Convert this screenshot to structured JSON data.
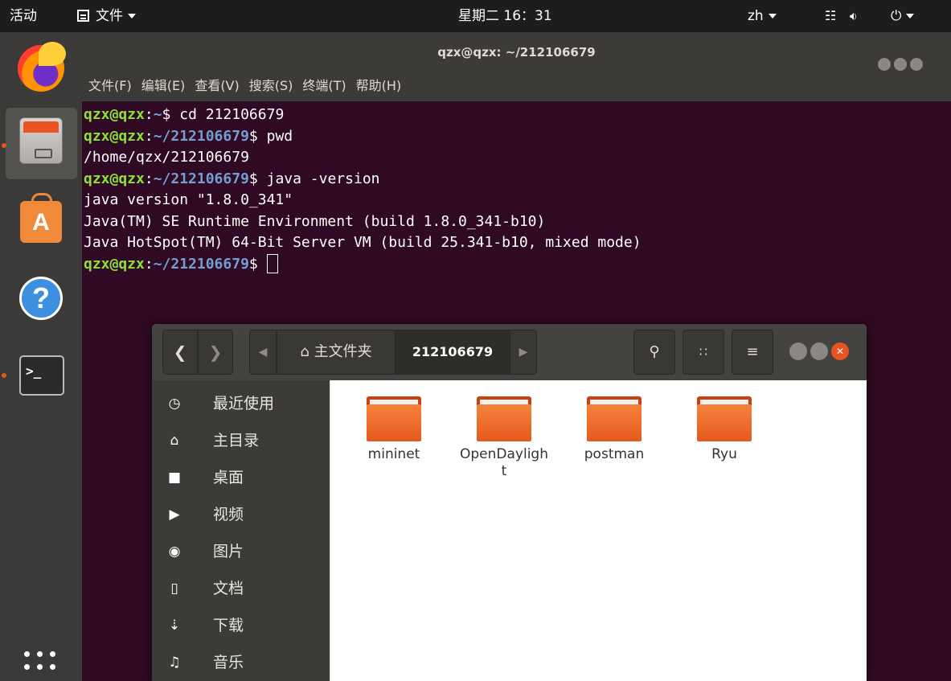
{
  "topbar": {
    "activities": "活动",
    "app_menu": "文件",
    "clock": "星期二 16：31",
    "input_method": "zh"
  },
  "dock": {
    "items": [
      "firefox",
      "files",
      "software",
      "help",
      "terminal"
    ]
  },
  "terminal": {
    "title": "qzx@qzx: ~/212106679",
    "menu": [
      "文件(F)",
      "编辑(E)",
      "查看(V)",
      "搜索(S)",
      "终端(T)",
      "帮助(H)"
    ],
    "prompt_user": "qzx@qzx",
    "lines": [
      {
        "prompt": true,
        "path": "~",
        "cmd": "cd 212106679"
      },
      {
        "prompt": true,
        "path": "~/212106679",
        "cmd": "pwd"
      },
      {
        "prompt": false,
        "text": "/home/qzx/212106679"
      },
      {
        "prompt": true,
        "path": "~/212106679",
        "cmd": "java -version"
      },
      {
        "prompt": false,
        "text": "java version \"1.8.0_341\""
      },
      {
        "prompt": false,
        "text": "Java(TM) SE Runtime Environment (build 1.8.0_341-b10)"
      },
      {
        "prompt": false,
        "text": "Java HotSpot(TM) 64-Bit Server VM (build 25.341-b10, mixed mode)"
      },
      {
        "prompt": true,
        "path": "~/212106679",
        "cmd": "",
        "cursor": true
      }
    ]
  },
  "file_manager": {
    "path_home": "主文件夹",
    "path_current": "212106679",
    "sidebar": [
      {
        "label": "最近使用",
        "icon": "clock-icon"
      },
      {
        "label": "主目录",
        "icon": "home-icon"
      },
      {
        "label": "桌面",
        "icon": "folder-icon"
      },
      {
        "label": "视频",
        "icon": "video-icon"
      },
      {
        "label": "图片",
        "icon": "camera-icon"
      },
      {
        "label": "文档",
        "icon": "document-icon"
      },
      {
        "label": "下载",
        "icon": "download-icon"
      },
      {
        "label": "音乐",
        "icon": "music-icon"
      }
    ],
    "folders": [
      "mininet",
      "OpenDaylight",
      "postman",
      "Ryu"
    ]
  },
  "colors": {
    "terminal_bg": "#300a24",
    "prompt_user": "#8ae234",
    "prompt_path": "#729fcf",
    "accent": "#e95420"
  }
}
